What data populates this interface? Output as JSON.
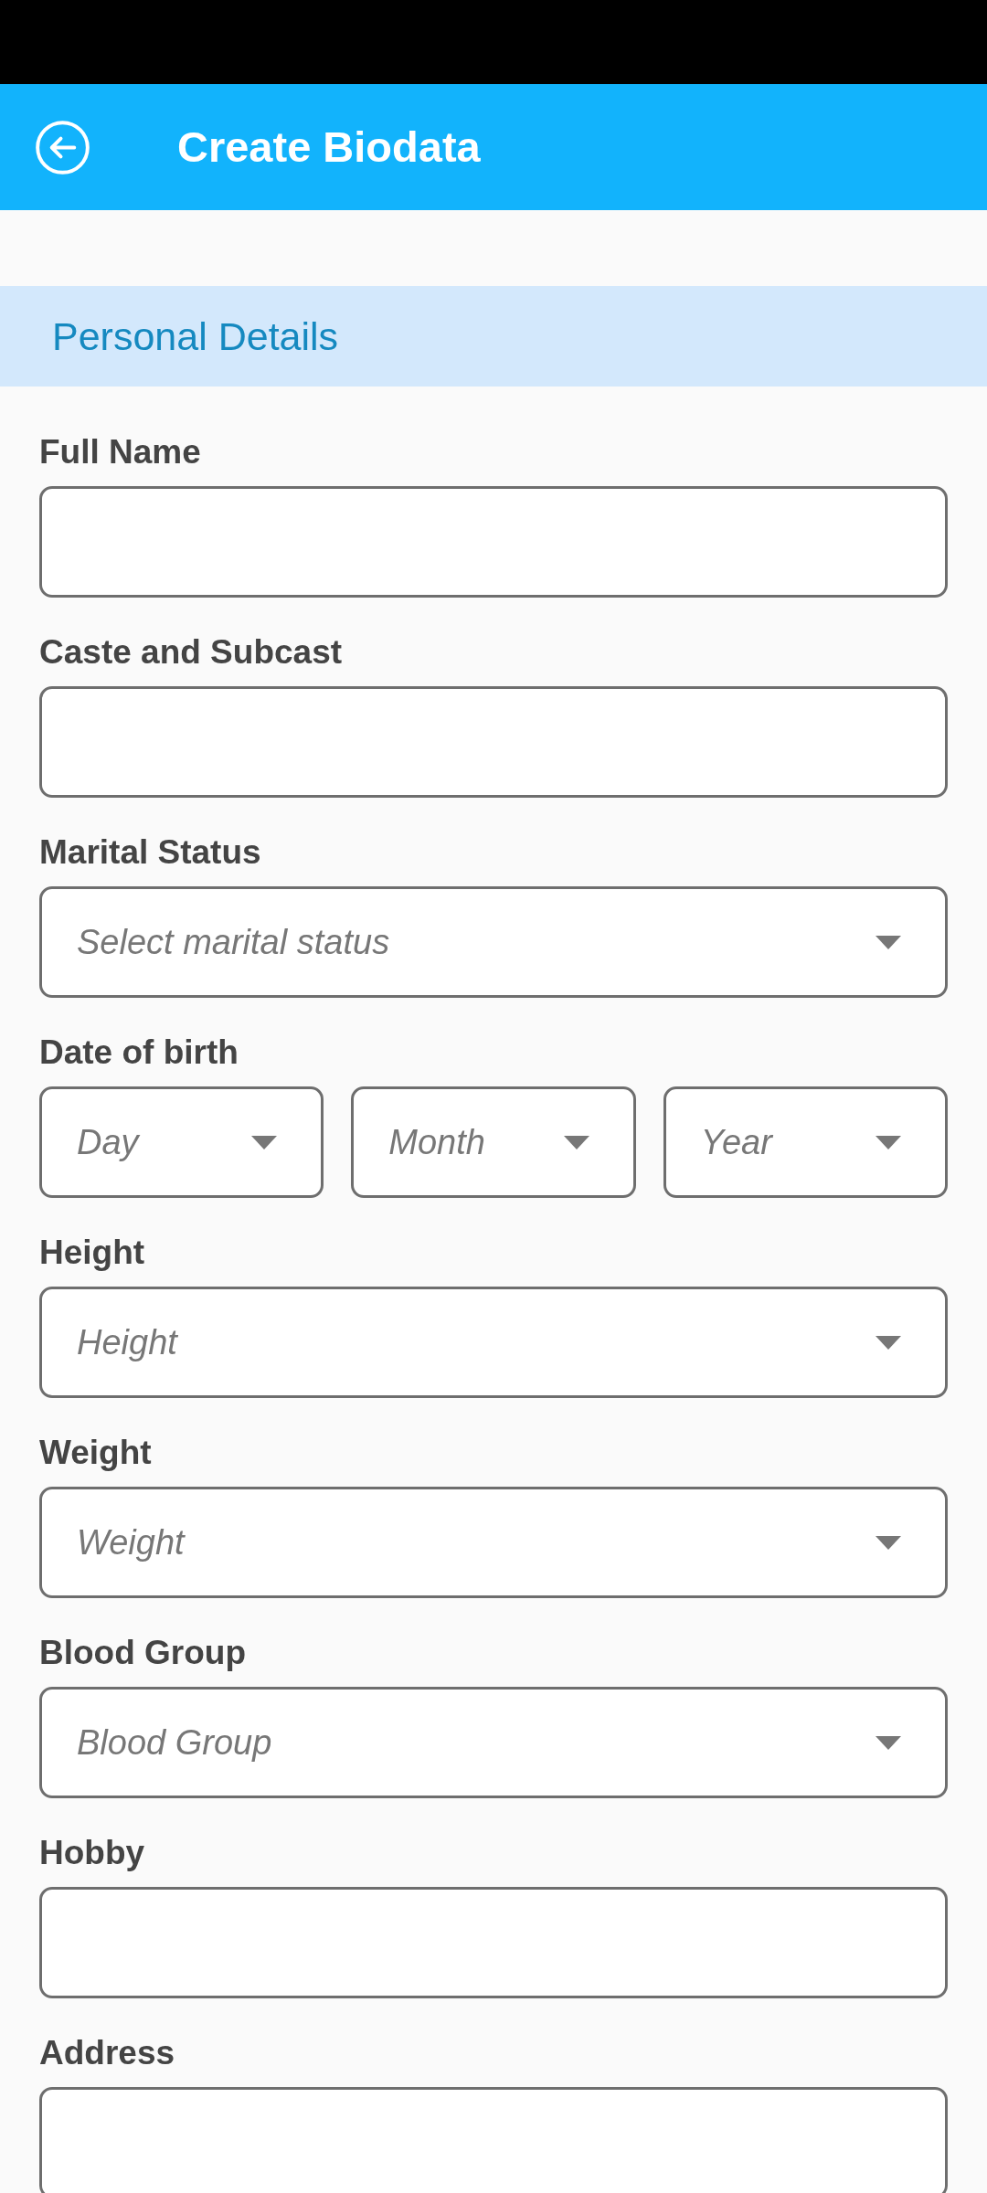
{
  "app_bar": {
    "title": "Create Biodata"
  },
  "section": {
    "title": "Personal Details"
  },
  "fields": [
    {
      "kind": "text",
      "label": "Full Name"
    },
    {
      "kind": "text",
      "label": "Caste and Subcast"
    },
    {
      "kind": "select",
      "label": "Marital Status",
      "placeholder": "Select marital status"
    },
    {
      "kind": "date",
      "label": "Date of birth",
      "parts": [
        {
          "placeholder": "Day"
        },
        {
          "placeholder": "Month"
        },
        {
          "placeholder": "Year"
        }
      ]
    },
    {
      "kind": "select",
      "label": "Height",
      "placeholder": "Height"
    },
    {
      "kind": "select",
      "label": "Weight",
      "placeholder": "Weight"
    },
    {
      "kind": "select",
      "label": "Blood Group",
      "placeholder": "Blood Group"
    },
    {
      "kind": "text",
      "label": "Hobby"
    },
    {
      "kind": "text",
      "label": "Address"
    }
  ]
}
